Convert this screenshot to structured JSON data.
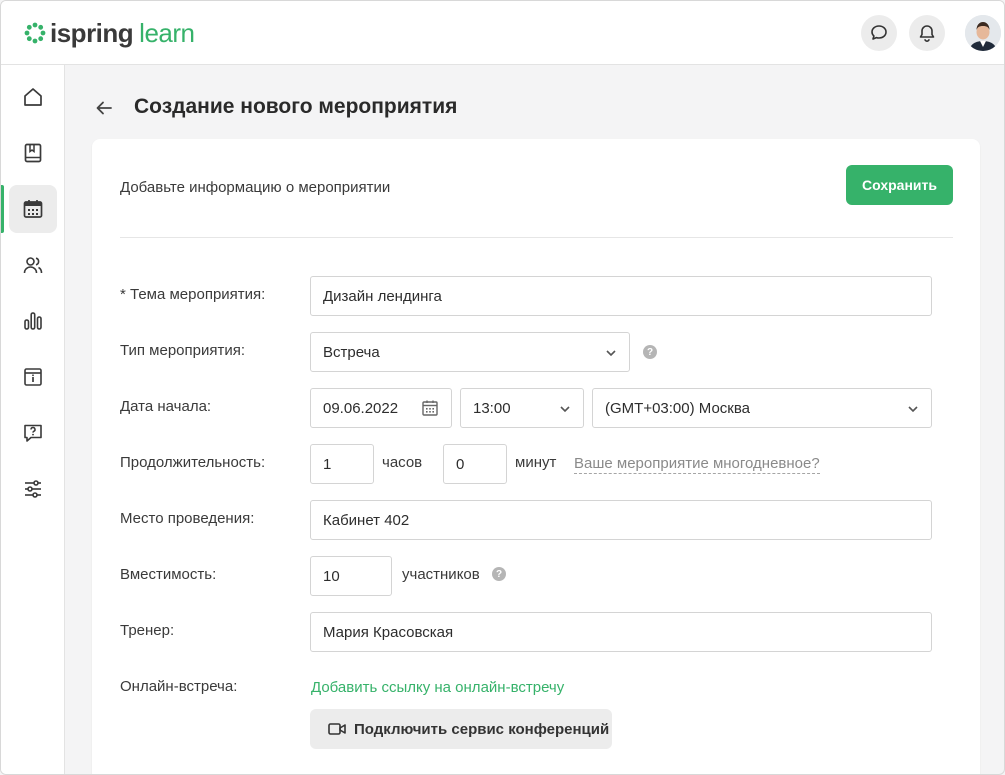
{
  "header": {
    "logo_primary": "ispring",
    "logo_secondary": "learn",
    "accent_color": "#36b26a",
    "icons": [
      "chat-bubble-icon",
      "bell-icon"
    ]
  },
  "sidebar": {
    "items": [
      {
        "name": "home",
        "icon": "home-icon",
        "active": false
      },
      {
        "name": "courses",
        "icon": "book-icon",
        "active": false
      },
      {
        "name": "calendar",
        "icon": "calendar-icon",
        "active": true
      },
      {
        "name": "users",
        "icon": "users-icon",
        "active": false
      },
      {
        "name": "reports",
        "icon": "bar-chart-icon",
        "active": false
      },
      {
        "name": "info",
        "icon": "info-card-icon",
        "active": false
      },
      {
        "name": "help",
        "icon": "help-chat-icon",
        "active": false
      },
      {
        "name": "settings",
        "icon": "sliders-icon",
        "active": false
      }
    ]
  },
  "page": {
    "title": "Создание нового мероприятия"
  },
  "form": {
    "subtitle": "Добавьте информацию о мероприятии",
    "save_label": "Сохранить",
    "topic": {
      "label": "* Тема мероприятия:",
      "value": "Дизайн лендинга"
    },
    "type": {
      "label": "Тип мероприятия:",
      "value": "Встреча"
    },
    "start_date": {
      "label": "Дата начала:",
      "date": "09.06.2022",
      "time": "13:00",
      "timezone": "(GMT+03:00) Москва"
    },
    "duration": {
      "label": "Продолжительность:",
      "hours": "1",
      "hours_unit": "часов",
      "minutes": "0",
      "minutes_unit": "минут",
      "multiday_link": "Ваше мероприятие многодневное?"
    },
    "location": {
      "label": "Место проведения:",
      "value": "Кабинет 402"
    },
    "capacity": {
      "label": "Вместимость:",
      "value": "10",
      "unit": "участников"
    },
    "trainer": {
      "label": "Тренер:",
      "value": "Мария Красовская"
    },
    "online": {
      "label": "Онлайн-встреча:",
      "link": "Добавить ссылку на онлайн-встречу",
      "connect_label": "Подключить сервис конференций"
    },
    "help_glyph": "?"
  }
}
